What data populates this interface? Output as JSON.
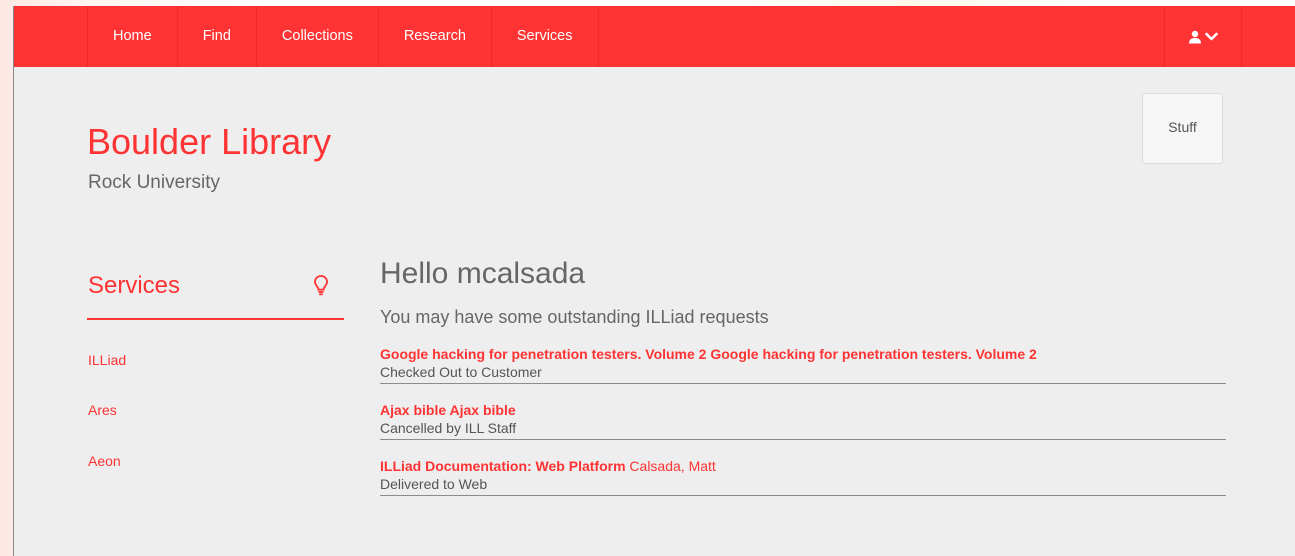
{
  "navbar": {
    "items": [
      {
        "label": "Home"
      },
      {
        "label": "Find"
      },
      {
        "label": "Collections"
      },
      {
        "label": "Research"
      },
      {
        "label": "Services"
      }
    ],
    "user_icon": "user-icon",
    "dropdown_icon": "chevron-down-icon"
  },
  "header": {
    "title": "Boulder Library",
    "subtitle": "Rock University",
    "stuff_button": "Stuff"
  },
  "sidebar": {
    "heading": "Services",
    "heading_icon": "lightbulb-icon",
    "items": [
      {
        "label": "ILLiad"
      },
      {
        "label": "Ares"
      },
      {
        "label": "Aeon"
      }
    ]
  },
  "main": {
    "greeting": "Hello mcalsada",
    "intro": "You may have some outstanding ILLiad requests",
    "requests": [
      {
        "title": "Google hacking for penetration testers. Volume 2 Google hacking for penetration testers. Volume 2",
        "author": "",
        "status": "Checked Out to Customer"
      },
      {
        "title": "Ajax bible Ajax bible",
        "author": "",
        "status": "Cancelled by ILL Staff"
      },
      {
        "title": "ILLiad Documentation: Web Platform",
        "author": "Calsada, Matt",
        "status": "Delivered to Web"
      }
    ]
  },
  "colors": {
    "accent": "#ff3333",
    "page_background": "#eeeeee",
    "text_muted": "#666666"
  }
}
